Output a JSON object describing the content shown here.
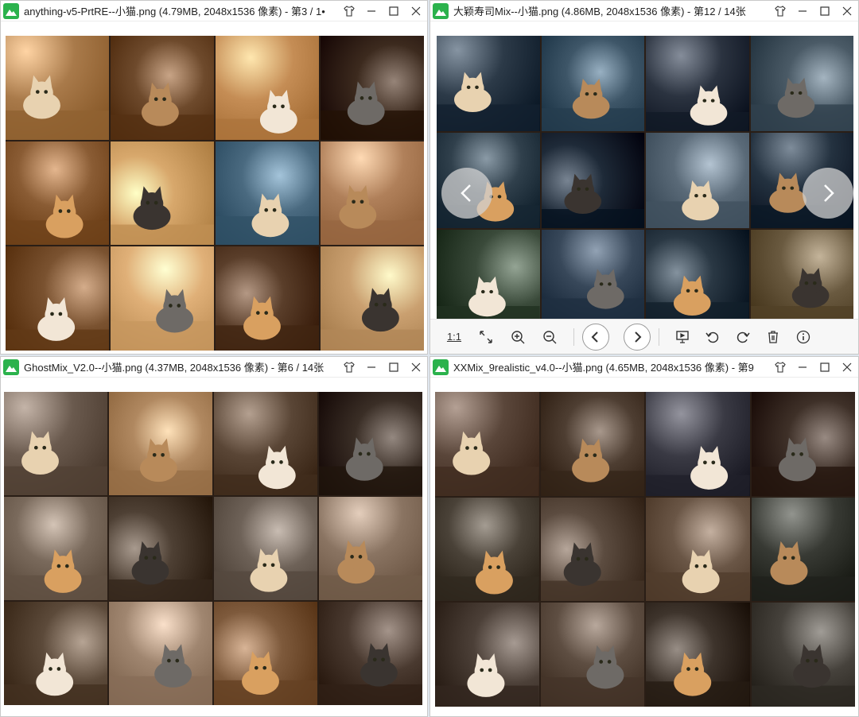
{
  "windows": [
    {
      "id": "w1",
      "title": "anything-v5-PrtRE--小猫.png (4.79MB, 2048x1536 像素) - 第3 / 1•",
      "palette": [
        "#a97a4a",
        "#6e4a2c",
        "#c58d55",
        "#3c2a1e",
        "#8a5c34",
        "#d8a86c",
        "#4a6a80",
        "#b0805a",
        "#7a5230",
        "#e0b078",
        "#5a3e2a",
        "#caa070"
      ]
    },
    {
      "id": "w2",
      "title": "大颖寿司Mix--小猫.png (4.86MB, 2048x1536 像素) - 第12 / 14张",
      "palette": [
        "#2c3a48",
        "#3e5668",
        "#2b3340",
        "#4a5a66",
        "#30404c",
        "#1e2a38",
        "#5a6a78",
        "#243240",
        "#3a4a3a",
        "#38485a",
        "#2a3844",
        "#6a5a40"
      ]
    },
    {
      "id": "w3",
      "title": "GhostMix_V2.0--小猫.png (4.37MB, 2048x1536 像素) - 第6 / 14张",
      "palette": [
        "#6a5a4e",
        "#b08860",
        "#5a4636",
        "#3a2e26",
        "#7a6a5c",
        "#4e4034",
        "#6e6258",
        "#8a7462",
        "#5c4a3a",
        "#a08670",
        "#7e5a3c",
        "#4a3a30"
      ]
    },
    {
      "id": "w4",
      "title": "XXMix_9realistic_v4.0--小猫.png (4.65MB, 2048x1536 像素) - 第9",
      "palette": [
        "#5a463a",
        "#4e3e32",
        "#3a3a44",
        "#3e3028",
        "#4a4238",
        "#5c4c40",
        "#6a5646",
        "#383a34",
        "#4c4038",
        "#5e4e42",
        "#3e342c",
        "#46423c"
      ]
    }
  ],
  "toolbar": {
    "ratio_label": "1:1"
  },
  "icons": {
    "app": "app-icon",
    "clothing": "shirt-icon",
    "minimize": "minimize-icon",
    "maximize": "maximize-icon",
    "close": "close-icon"
  }
}
